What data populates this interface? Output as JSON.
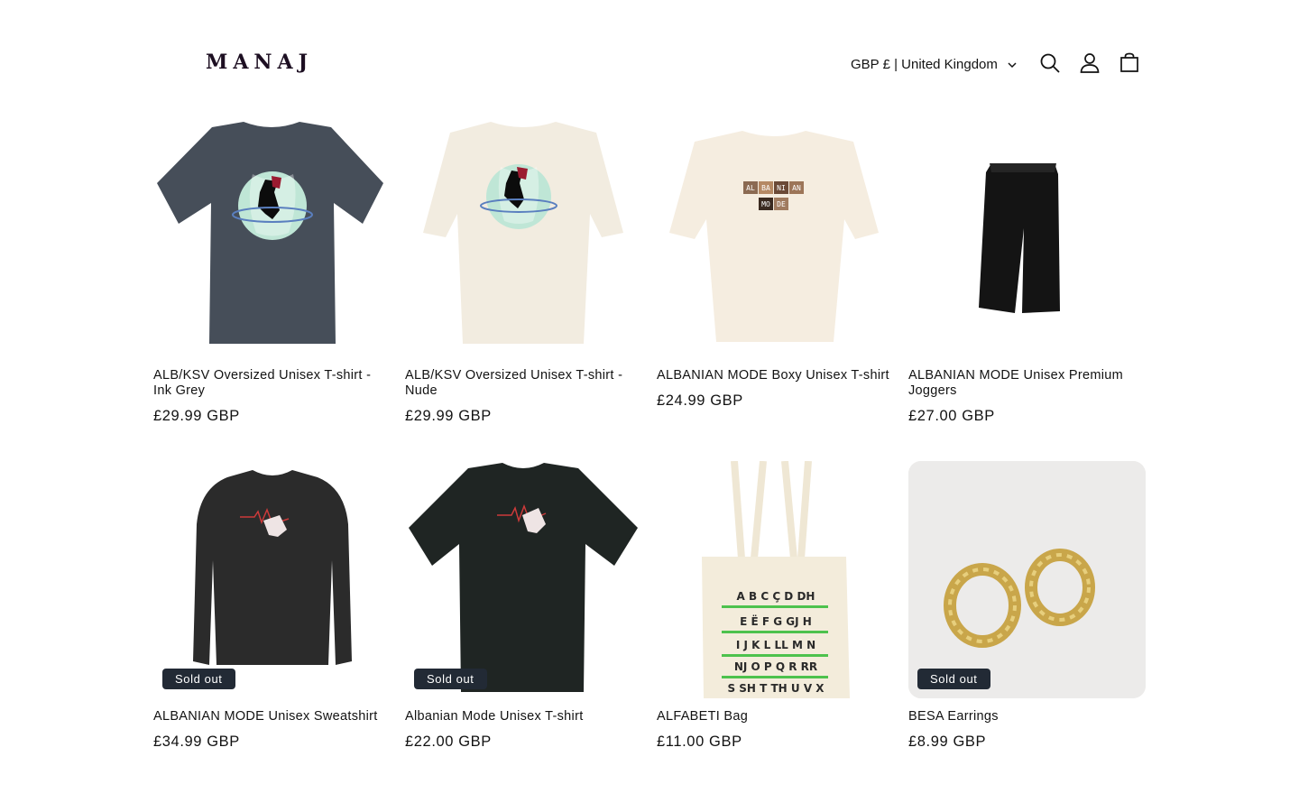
{
  "header": {
    "logo": "MANAJ",
    "currency_label": "GBP £ | United Kingdom"
  },
  "icons": {
    "search": "search-icon",
    "account": "account-icon",
    "cart": "cart-icon"
  },
  "products": [
    {
      "title": "ALB/KSV Oversized Unisex T-shirt - Ink Grey",
      "price": "£29.99 GBP",
      "badge": ""
    },
    {
      "title": "ALB/KSV Oversized Unisex T-shirt - Nude",
      "price": "£29.99 GBP",
      "badge": ""
    },
    {
      "title": "ALBANIAN MODE Boxy Unisex T-shirt",
      "price": "£24.99 GBP",
      "badge": ""
    },
    {
      "title": "ALBANIAN MODE Unisex Premium Joggers",
      "price": "£27.00 GBP",
      "badge": ""
    },
    {
      "title": "ALBANIAN MODE Unisex Sweatshirt",
      "price": "£34.99 GBP",
      "badge": "Sold out"
    },
    {
      "title": "Albanian Mode Unisex T-shirt",
      "price": "£22.00 GBP",
      "badge": "Sold out"
    },
    {
      "title": "ALFABETI Bag",
      "price": "£11.00 GBP",
      "badge": ""
    },
    {
      "title": "BESA Earrings",
      "price": "£8.99 GBP",
      "badge": "Sold out"
    }
  ],
  "image_text": {
    "boxy_print_row1": [
      "AL",
      "BA",
      "NI",
      "AN"
    ],
    "boxy_print_row2": [
      "MO",
      "DE"
    ],
    "bag_letters": [
      "A B C Ç D DH",
      "E Ë F G GJ H",
      "I J K L LL M N",
      "NJ O P Q R RR",
      "S SH T TH U V X"
    ]
  },
  "colors": {
    "text": "#121212",
    "badge_bg": "#222a35",
    "ink_grey": "#464e59",
    "nude": "#f2ece0",
    "black_garment": "#2b2b2b"
  }
}
